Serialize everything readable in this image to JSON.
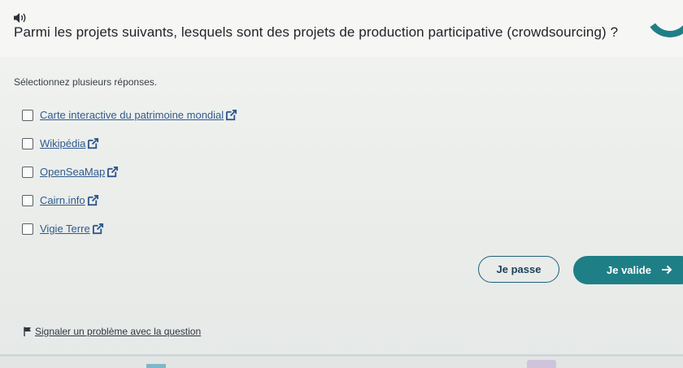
{
  "question": {
    "text": "Parmi les projets suivants, lesquels sont des projets de production participative (crowdsourcing) ?",
    "audio_icon": "speaker-icon"
  },
  "instruction": "Sélectionnez plusieurs réponses.",
  "options": [
    {
      "label": "Carte interactive du patrimoine mondial",
      "checked": false,
      "icon": "external-link-icon"
    },
    {
      "label": "Wikipédia",
      "checked": false,
      "icon": "external-link-icon"
    },
    {
      "label": "OpenSeaMap",
      "checked": false,
      "icon": "external-link-icon"
    },
    {
      "label": "Cairn.info",
      "checked": false,
      "icon": "external-link-icon"
    },
    {
      "label": "Vigie Terre",
      "checked": false,
      "icon": "external-link-icon"
    }
  ],
  "buttons": {
    "skip_label": "Je passe",
    "validate_label": "Je valide",
    "validate_icon": "arrow-right-icon"
  },
  "report": {
    "label": "Signaler un problème avec la question",
    "icon": "flag-icon"
  },
  "colors": {
    "accent": "#1f7f86",
    "link": "#2f5a8e",
    "text": "#1e2328"
  }
}
